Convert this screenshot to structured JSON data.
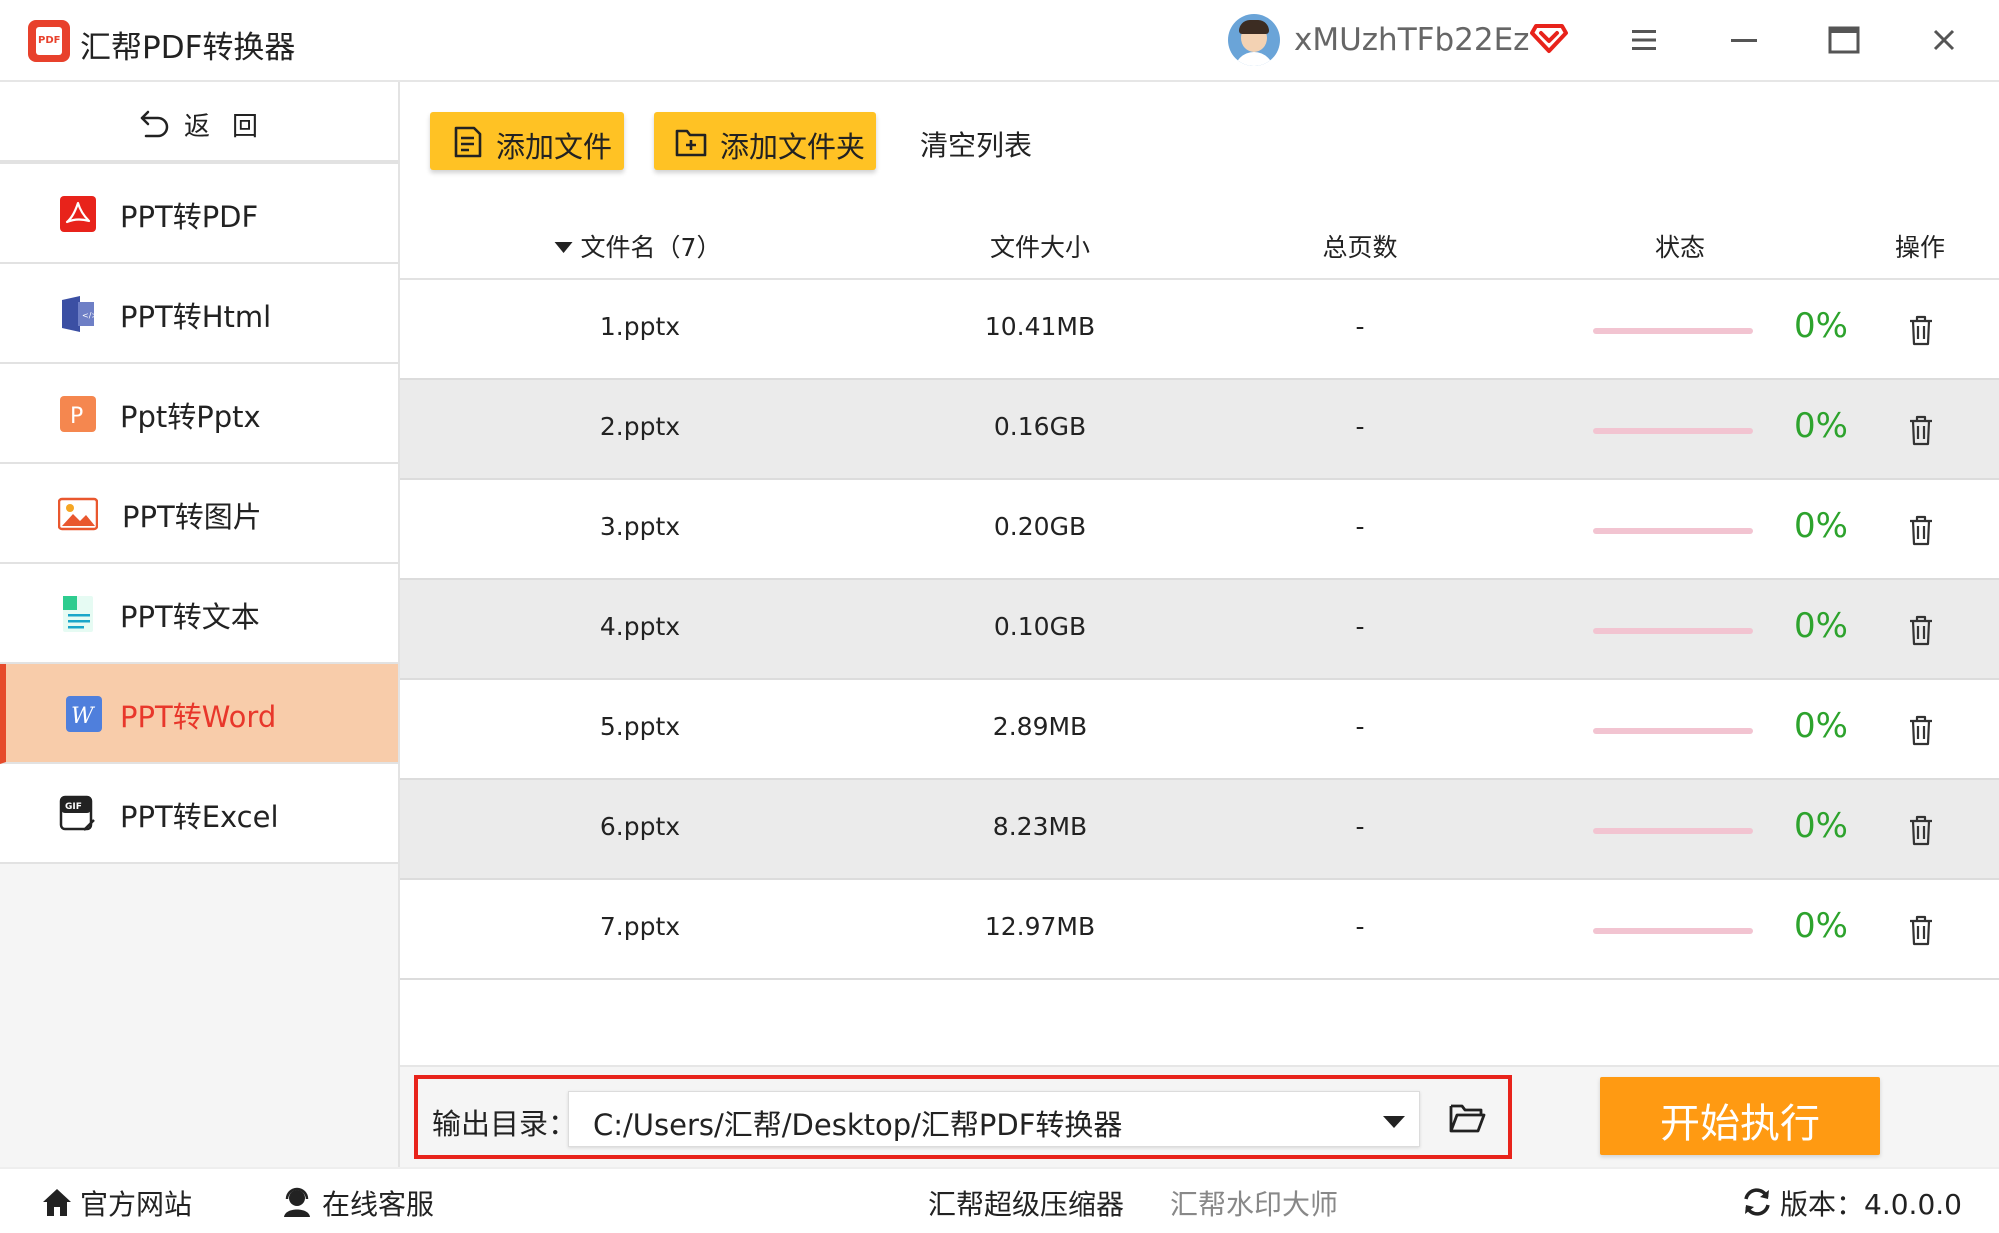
{
  "app": {
    "title": "汇帮PDF转换器",
    "logo_text": "PDF",
    "username": "xMUzhTFb22Ez",
    "icons": [
      "app-logo-icon",
      "avatar",
      "vip-diamond-icon",
      "menu-icon",
      "minimize-icon",
      "maximize-icon",
      "close-icon"
    ]
  },
  "sidebar": {
    "back_label": "返回",
    "items": [
      {
        "label": "PPT转PDF",
        "icon": "pdf-icon",
        "active": false
      },
      {
        "label": "PPT转Html",
        "icon": "html-icon",
        "active": false
      },
      {
        "label": "Ppt转Pptx",
        "icon": "pptx-icon",
        "active": false
      },
      {
        "label": "PPT转图片",
        "icon": "image-icon",
        "active": false
      },
      {
        "label": "PPT转文本",
        "icon": "text-icon",
        "active": false
      },
      {
        "label": "PPT转Word",
        "icon": "word-icon",
        "active": true
      },
      {
        "label": "PPT转Excel",
        "icon": "excel-icon",
        "active": false
      }
    ]
  },
  "toolbar": {
    "add_file": "添加文件",
    "add_folder": "添加文件夹",
    "clear_list": "清空列表"
  },
  "table": {
    "headers": {
      "filename": "文件名（7）",
      "size": "文件大小",
      "pages": "总页数",
      "status": "状态",
      "action": "操作"
    },
    "rows": [
      {
        "name": "1.pptx",
        "size": "10.41MB",
        "pages": "-",
        "progress": 0,
        "percent": "0%"
      },
      {
        "name": "2.pptx",
        "size": "0.16GB",
        "pages": "-",
        "progress": 0,
        "percent": "0%"
      },
      {
        "name": "3.pptx",
        "size": "0.20GB",
        "pages": "-",
        "progress": 0,
        "percent": "0%"
      },
      {
        "name": "4.pptx",
        "size": "0.10GB",
        "pages": "-",
        "progress": 0,
        "percent": "0%"
      },
      {
        "name": "5.pptx",
        "size": "2.89MB",
        "pages": "-",
        "progress": 0,
        "percent": "0%"
      },
      {
        "name": "6.pptx",
        "size": "8.23MB",
        "pages": "-",
        "progress": 0,
        "percent": "0%"
      },
      {
        "name": "7.pptx",
        "size": "12.97MB",
        "pages": "-",
        "progress": 0,
        "percent": "0%"
      }
    ]
  },
  "output": {
    "label": "输出目录：",
    "path": "C:/Users/汇帮/Desktop/汇帮PDF转换器",
    "start_label": "开始执行"
  },
  "footer": {
    "website": "官方网站",
    "service": "在线客服",
    "compressor": "汇帮超级压缩器",
    "watermark": "汇帮水印大师",
    "version_label": "版本：",
    "version": "4.0.0.0"
  },
  "colors": {
    "accent_yellow": "#ffc224",
    "start_orange": "#ff9a12",
    "active_bg": "#f8ccaa",
    "active_text": "#e8372b",
    "progress_track": "#f2c4d1",
    "percent_green": "#2da32d",
    "highlight_border": "#e8231b"
  }
}
